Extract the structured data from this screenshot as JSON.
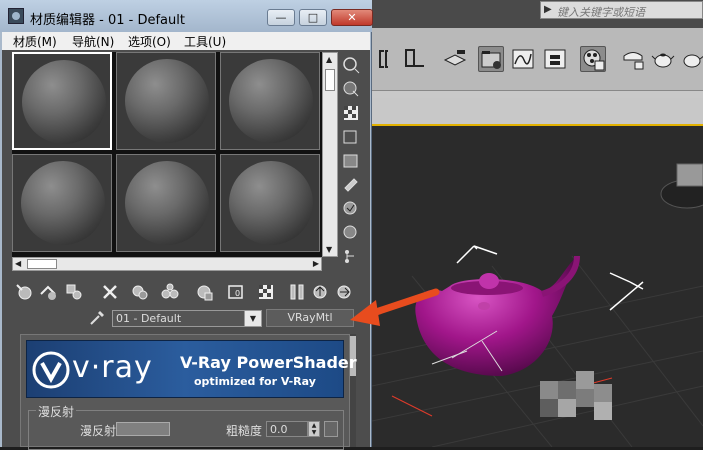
{
  "window": {
    "title": "材质编辑器 - 01 - Default",
    "minimize": "—",
    "maximize": "□",
    "close": "✕"
  },
  "menu": [
    "材质(M)",
    "导航(N)",
    "选项(O)",
    "工具(U)"
  ],
  "max_search": {
    "placeholder": "键入关键字或短语"
  },
  "slots": {
    "count": 6,
    "selected_index": 0
  },
  "material": {
    "name": "01 - Default",
    "type": "VRayMtl"
  },
  "vray_banner": {
    "logo": "v·ray",
    "title": "V-Ray PowerShader",
    "subtitle": "optimized for V-Ray"
  },
  "diffuse": {
    "group_title": "漫反射",
    "label": "漫反射",
    "roughness_label": "粗糙度",
    "roughness_value": "0.0"
  },
  "colors": {
    "teapot": "#a1168a",
    "highlight_arrow": "#e84c1e",
    "vray_blue": "#2b5d9e",
    "selection_accent": "#e2b100"
  }
}
